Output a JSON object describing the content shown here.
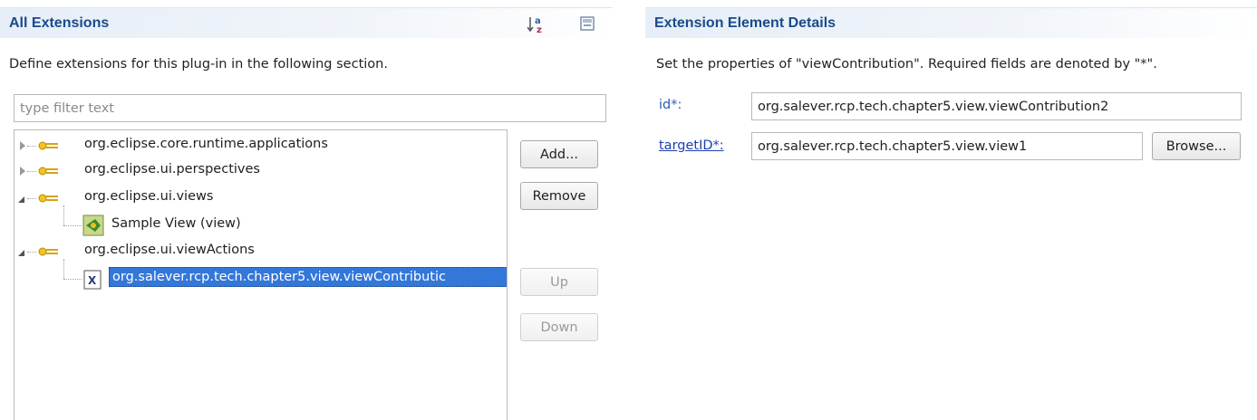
{
  "left": {
    "title": "All Extensions",
    "description": "Define extensions for this plug-in in the following section.",
    "filter_placeholder": "type filter text",
    "tree": [
      {
        "label": "org.eclipse.core.runtime.applications",
        "icon": "extension-point-icon"
      },
      {
        "label": "org.eclipse.ui.perspectives",
        "icon": "extension-point-icon"
      },
      {
        "label": "org.eclipse.ui.views",
        "icon": "extension-point-icon"
      },
      {
        "label": "Sample View (view)",
        "icon": "view-icon"
      },
      {
        "label": "org.eclipse.ui.viewActions",
        "icon": "extension-point-icon"
      },
      {
        "label": "org.salever.rcp.tech.chapter5.view.viewContributic",
        "icon": "xml-element-icon"
      }
    ],
    "buttons": {
      "add": "Add...",
      "remove": "Remove",
      "up": "Up",
      "down": "Down"
    }
  },
  "right": {
    "title": "Extension Element Details",
    "description": "Set the properties of \"viewContribution\". Required fields are denoted by \"*\".",
    "id_label": "id*:",
    "id_value": "org.salever.rcp.tech.chapter5.view.viewContribution2",
    "target_label": "targetID*:",
    "target_value": "org.salever.rcp.tech.chapter5.view.view1",
    "browse": "Browse..."
  }
}
